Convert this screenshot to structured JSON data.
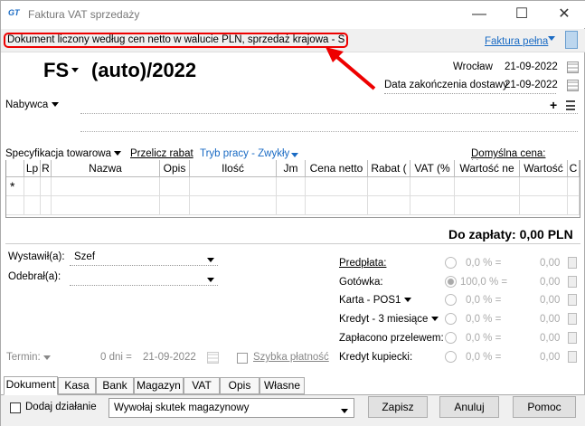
{
  "window": {
    "title": "Faktura VAT sprzedaży",
    "logo_text": "GT",
    "min": "—",
    "max": "☐",
    "close": "✕"
  },
  "infobar": {
    "text": "Dokument liczony według cen netto w walucie PLN, sprzedaż krajowa - S",
    "mode_link": "Faktura pełna"
  },
  "header": {
    "doc_type": "FS",
    "doc_number": "(auto)/2022",
    "place": "Wrocław",
    "date": "21-09-2022",
    "delivery_label": "Data zakończenia dostawy",
    "delivery_date": "21-09-2022"
  },
  "buyer": {
    "label": "Nabywca",
    "add": "+"
  },
  "toolbar": {
    "spec": "Specyfikacja towarowa",
    "recalc": "Przelicz rabat",
    "mode": "Tryb pracy - Zwykły",
    "price": "Domyślna cena: Hurtowa"
  },
  "table": {
    "headers": [
      "",
      "Lp",
      "R",
      "Nazwa",
      "Opis",
      "Ilość",
      "Jm",
      "Cena netto",
      "Rabat (",
      "VAT (%",
      "Wartość ne",
      "Wartość",
      "C"
    ],
    "new_row": "*"
  },
  "total": {
    "label": "Do zapłaty: 0,00 PLN"
  },
  "left": {
    "issued_label": "Wystawił(a):",
    "issued_value": "Szef",
    "received_label": "Odebrał(a):",
    "term_label": "Termin:",
    "days": "0 dni =",
    "term_date": "21-09-2022",
    "quick": "Szybka płatność"
  },
  "payments": [
    {
      "label": "Predpłata:",
      "pct": "0,0 % =",
      "amt": "0,00",
      "selected": false,
      "underline": true,
      "dd": false
    },
    {
      "label": "Gotówka:",
      "pct": "100,0 % =",
      "amt": "0,00",
      "selected": true,
      "underline": false,
      "dd": false
    },
    {
      "label": "Karta - POS1",
      "pct": "0,0 % =",
      "amt": "0,00",
      "selected": false,
      "underline": false,
      "dd": true
    },
    {
      "label": "Kredyt - 3 miesiące",
      "pct": "0,0 % =",
      "amt": "0,00",
      "selected": false,
      "underline": false,
      "dd": true
    },
    {
      "label": "Zapłacono przelewem:",
      "pct": "0,0 % =",
      "amt": "0,00",
      "selected": false,
      "underline": false,
      "dd": false
    },
    {
      "label": "Kredyt kupiecki:",
      "pct": "0,0 % =",
      "amt": "0,00",
      "selected": false,
      "underline": false,
      "dd": false
    }
  ],
  "tabs": [
    "Dokument",
    "Kasa",
    "Bank",
    "Magazyn",
    "VAT",
    "Opis",
    "Własne"
  ],
  "bottom": {
    "action_label": "Dodaj działanie",
    "effect": "Wywołaj skutek magazynowy",
    "save": "Zapisz",
    "cancel": "Anuluj",
    "help": "Pomoc"
  },
  "colors": {
    "accent": "#1a6bc4",
    "highlight": "#e00000"
  }
}
